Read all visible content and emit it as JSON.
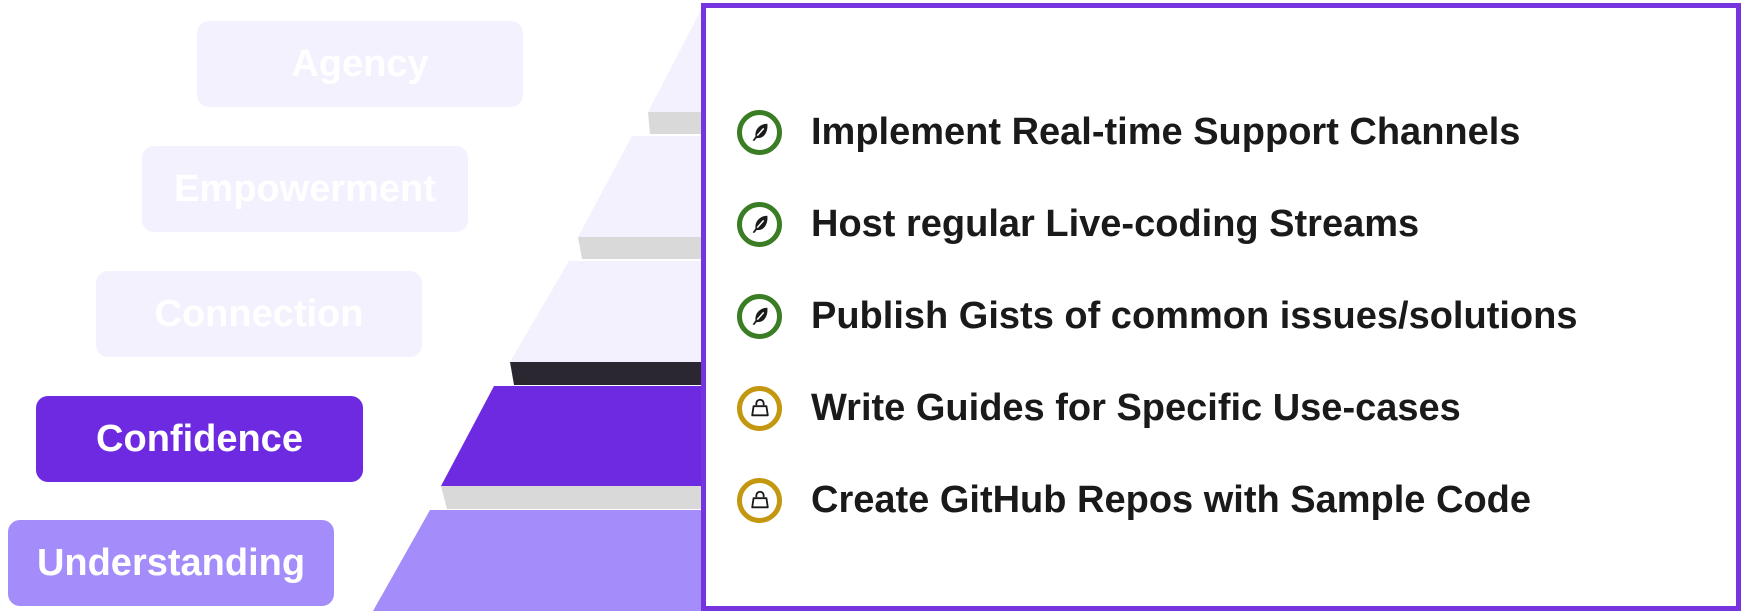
{
  "levels": [
    {
      "key": "agency",
      "label": "Agency"
    },
    {
      "key": "empowerment",
      "label": "Empowerment"
    },
    {
      "key": "connection",
      "label": "Connection"
    },
    {
      "key": "confidence",
      "label": "Confidence"
    },
    {
      "key": "understanding",
      "label": "Understanding"
    }
  ],
  "active_level": "confidence",
  "colors": {
    "faded": "#f3f1fd",
    "confidence": "#6d2ae0",
    "understanding": "#a48cfb",
    "panel_border": "#7534dd",
    "feather_icon": "#3b7d25",
    "bag_icon": "#c3970f"
  },
  "items": [
    {
      "icon": "feather-icon",
      "text": "Implement Real-time Support Channels"
    },
    {
      "icon": "feather-icon",
      "text": "Host regular Live-coding Streams"
    },
    {
      "icon": "feather-icon",
      "text": "Publish Gists of common issues/solutions"
    },
    {
      "icon": "bag-icon",
      "text": "Write Guides for Specific Use-cases"
    },
    {
      "icon": "bag-icon",
      "text": "Create GitHub Repos with Sample Code"
    }
  ]
}
